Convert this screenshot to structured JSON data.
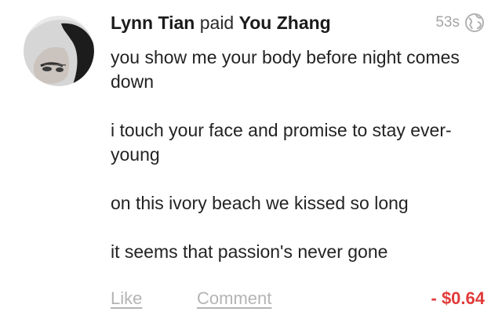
{
  "story": {
    "actor": "Lynn Tian",
    "verb": "paid",
    "target": "You Zhang",
    "time": "53s",
    "message_paragraphs": [
      "you show me your body before night comes down",
      "i touch your face and promise to stay ever-young",
      "on this ivory beach we kissed so long",
      "it seems that passion's never gone"
    ],
    "like_label": "Like",
    "comment_label": "Comment",
    "amount": "- $0.64"
  },
  "icons": {
    "avatar": "profile-photo",
    "audience": "globe-icon"
  },
  "colors": {
    "amount_negative": "#e23a3a",
    "muted": "#a5a5a5"
  }
}
